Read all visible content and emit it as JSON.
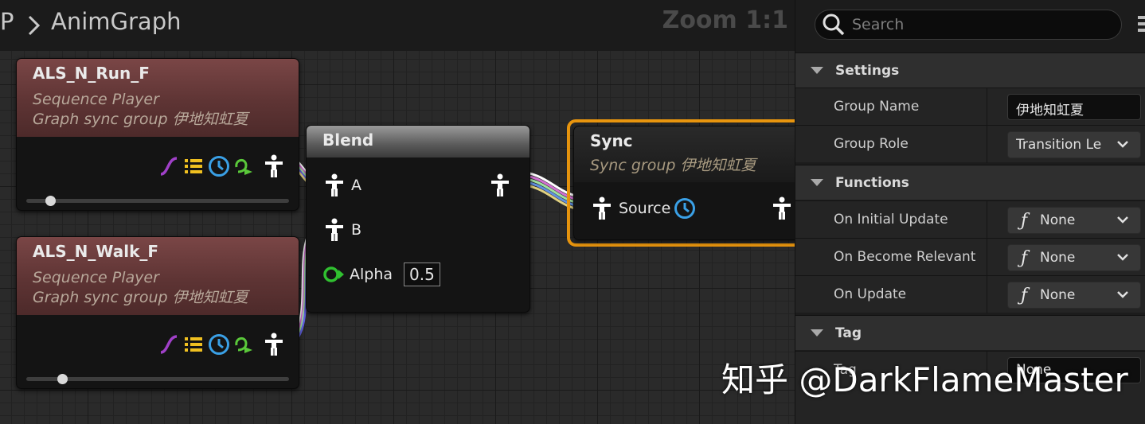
{
  "breadcrumb": {
    "parent": "P",
    "current": "AnimGraph",
    "zoom": "Zoom 1:1"
  },
  "nodes": {
    "run": {
      "title": "ALS_N_Run_F",
      "subtitle": "Sequence Player",
      "sync": "Graph sync group 伊地知虹夏",
      "position": 0.12
    },
    "walk": {
      "title": "ALS_N_Walk_F",
      "subtitle": "Sequence Player",
      "sync": "Graph sync group 伊地知虹夏",
      "position": 0.14
    },
    "blend": {
      "title": "Blend",
      "pin_a": "A",
      "pin_b": "B",
      "alpha_label": "Alpha",
      "alpha_value": "0.5"
    },
    "sync": {
      "title": "Sync",
      "subtitle": "Sync group 伊地知虹夏",
      "source_label": "Source"
    }
  },
  "details": {
    "search_placeholder": "Search",
    "settings": {
      "label": "Settings",
      "group_name_label": "Group Name",
      "group_name_value": "伊地知虹夏",
      "group_role_label": "Group Role",
      "group_role_value": "Transition Le"
    },
    "functions": {
      "label": "Functions",
      "items": [
        {
          "label": "On Initial Update",
          "value": "None"
        },
        {
          "label": "On Become Relevant",
          "value": "None"
        },
        {
          "label": "On Update",
          "value": "None"
        }
      ]
    },
    "tag": {
      "label": "Tag",
      "tag_label": "Tag",
      "tag_value": "None"
    }
  },
  "watermark": "知乎 @DarkFlameMaster",
  "colors": {
    "sequence_header": "#6b3b3b",
    "sync_border": "#e8950e",
    "pose_pin": "#ffffff",
    "time_icon": "#3aa0e6",
    "curve_icon": "#a040c8",
    "list_icon": "#f0c020",
    "float_pin": "#30c030"
  }
}
